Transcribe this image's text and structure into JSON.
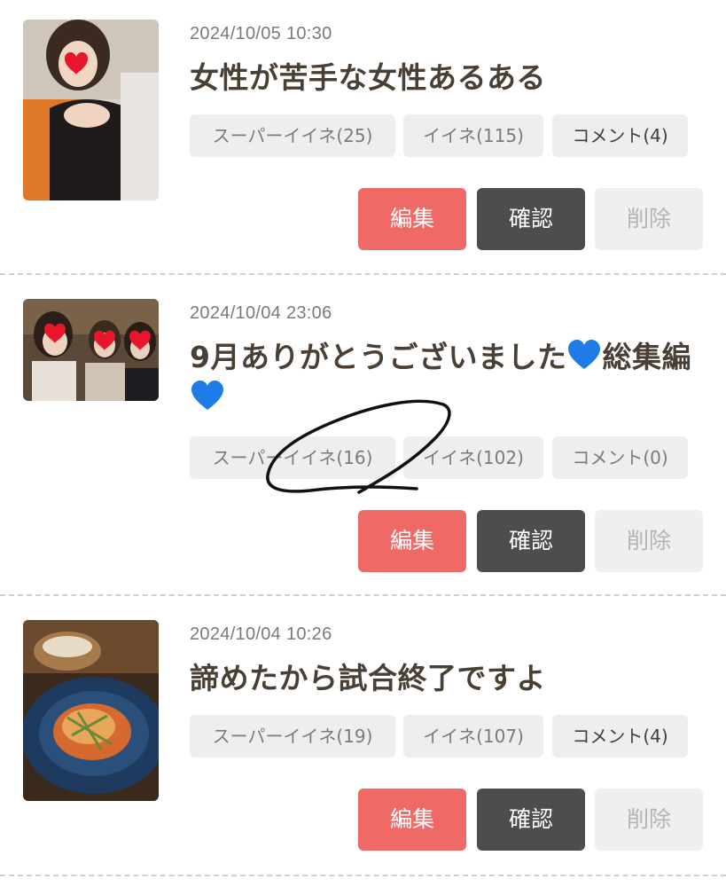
{
  "posts": [
    {
      "date": "2024/10/05 10:30",
      "title": "女性が苦手な女性あるある",
      "title_heart": false,
      "super_like": "スーパーイイネ(25)",
      "like": "イイネ(115)",
      "comment": "コメント(4)",
      "edit": "編集",
      "confirm": "確認",
      "delete": "削除"
    },
    {
      "date": "2024/10/04 23:06",
      "title": "9月ありがとうございました",
      "title_part2": "総集編",
      "title_heart": true,
      "super_like": "スーパーイイネ(16)",
      "like": "イイネ(102)",
      "comment": "コメント(0)",
      "edit": "編集",
      "confirm": "確認",
      "delete": "削除"
    },
    {
      "date": "2024/10/04 10:26",
      "title": "諦めたから試合終了ですよ",
      "title_heart": false,
      "super_like": "スーパーイイネ(19)",
      "like": "イイネ(107)",
      "comment": "コメント(4)",
      "edit": "編集",
      "confirm": "確認",
      "delete": "削除"
    }
  ],
  "colors": {
    "edit": "#ef6a66",
    "confirm": "#4d4d4d",
    "delete": "#efefef",
    "heart_blue": "#1e7be8",
    "heart_red": "#e8152b"
  },
  "icons": {
    "title_heart": "blue-heart-icon",
    "sticker": "red-heart-sticker"
  }
}
